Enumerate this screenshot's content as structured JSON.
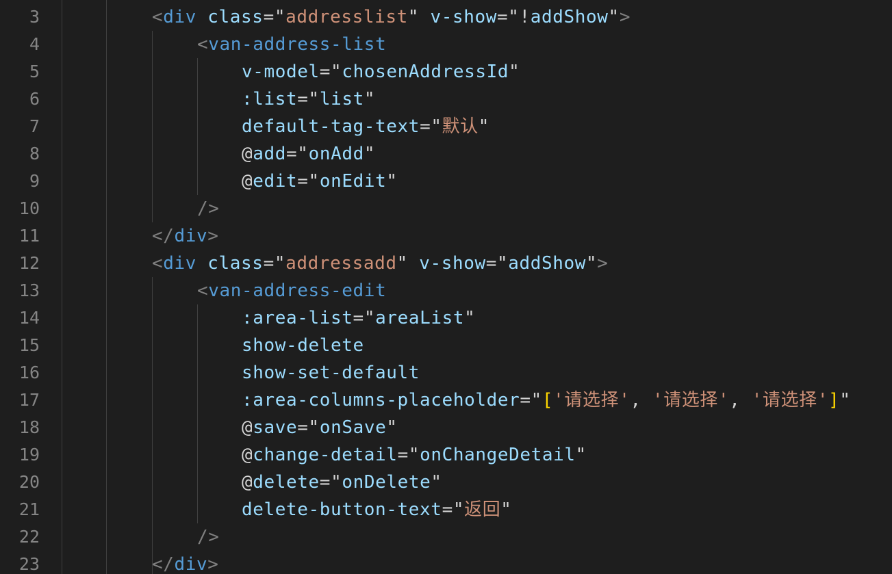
{
  "colors": {
    "background": "#1e1e1e",
    "line_number": "#858585",
    "tag": "#569cd6",
    "attribute": "#9cdcfe",
    "string": "#ce9178",
    "punctuation": "#808080",
    "bracket": "#ffd700",
    "text": "#d4d4d4"
  },
  "lines": [
    {
      "number": "3",
      "indent": 2,
      "tokens": [
        {
          "k": "punct",
          "t": "<"
        },
        {
          "k": "tag",
          "t": "div"
        },
        {
          "k": "plain",
          "t": " "
        },
        {
          "k": "attr",
          "t": "class"
        },
        {
          "k": "eq",
          "t": "="
        },
        {
          "k": "quote",
          "t": "\""
        },
        {
          "k": "str",
          "t": "addresslist"
        },
        {
          "k": "quote",
          "t": "\""
        },
        {
          "k": "plain",
          "t": " "
        },
        {
          "k": "attr",
          "t": "v-show"
        },
        {
          "k": "eq",
          "t": "="
        },
        {
          "k": "quote",
          "t": "\""
        },
        {
          "k": "plain",
          "t": "!"
        },
        {
          "k": "val",
          "t": "addShow"
        },
        {
          "k": "quote",
          "t": "\""
        },
        {
          "k": "punct",
          "t": ">"
        }
      ]
    },
    {
      "number": "4",
      "indent": 3,
      "tokens": [
        {
          "k": "punct",
          "t": "<"
        },
        {
          "k": "tag",
          "t": "van-address-list"
        }
      ]
    },
    {
      "number": "5",
      "indent": 4,
      "tokens": [
        {
          "k": "attr",
          "t": "v-model"
        },
        {
          "k": "eq",
          "t": "="
        },
        {
          "k": "quote",
          "t": "\""
        },
        {
          "k": "val",
          "t": "chosenAddressId"
        },
        {
          "k": "quote",
          "t": "\""
        }
      ]
    },
    {
      "number": "6",
      "indent": 4,
      "tokens": [
        {
          "k": "attr",
          "t": ":list"
        },
        {
          "k": "eq",
          "t": "="
        },
        {
          "k": "quote",
          "t": "\""
        },
        {
          "k": "val",
          "t": "list"
        },
        {
          "k": "quote",
          "t": "\""
        }
      ]
    },
    {
      "number": "7",
      "indent": 4,
      "tokens": [
        {
          "k": "attr",
          "t": "default-tag-text"
        },
        {
          "k": "eq",
          "t": "="
        },
        {
          "k": "quote",
          "t": "\""
        },
        {
          "k": "str",
          "t": "默认"
        },
        {
          "k": "quote",
          "t": "\""
        }
      ]
    },
    {
      "number": "8",
      "indent": 4,
      "tokens": [
        {
          "k": "at",
          "t": "@"
        },
        {
          "k": "attr",
          "t": "add"
        },
        {
          "k": "eq",
          "t": "="
        },
        {
          "k": "quote",
          "t": "\""
        },
        {
          "k": "val",
          "t": "onAdd"
        },
        {
          "k": "quote",
          "t": "\""
        }
      ]
    },
    {
      "number": "9",
      "indent": 4,
      "tokens": [
        {
          "k": "at",
          "t": "@"
        },
        {
          "k": "attr",
          "t": "edit"
        },
        {
          "k": "eq",
          "t": "="
        },
        {
          "k": "quote",
          "t": "\""
        },
        {
          "k": "val",
          "t": "onEdit"
        },
        {
          "k": "quote",
          "t": "\""
        }
      ]
    },
    {
      "number": "10",
      "indent": 3,
      "tokens": [
        {
          "k": "punct",
          "t": "/>"
        }
      ]
    },
    {
      "number": "11",
      "indent": 2,
      "tokens": [
        {
          "k": "punct",
          "t": "</"
        },
        {
          "k": "tag",
          "t": "div"
        },
        {
          "k": "punct",
          "t": ">"
        }
      ]
    },
    {
      "number": "12",
      "indent": 2,
      "tokens": [
        {
          "k": "punct",
          "t": "<"
        },
        {
          "k": "tag",
          "t": "div"
        },
        {
          "k": "plain",
          "t": " "
        },
        {
          "k": "attr",
          "t": "class"
        },
        {
          "k": "eq",
          "t": "="
        },
        {
          "k": "quote",
          "t": "\""
        },
        {
          "k": "str",
          "t": "addressadd"
        },
        {
          "k": "quote",
          "t": "\""
        },
        {
          "k": "plain",
          "t": " "
        },
        {
          "k": "attr",
          "t": "v-show"
        },
        {
          "k": "eq",
          "t": "="
        },
        {
          "k": "quote",
          "t": "\""
        },
        {
          "k": "val",
          "t": "addShow"
        },
        {
          "k": "quote",
          "t": "\""
        },
        {
          "k": "punct",
          "t": ">"
        }
      ]
    },
    {
      "number": "13",
      "indent": 3,
      "tokens": [
        {
          "k": "punct",
          "t": "<"
        },
        {
          "k": "tag",
          "t": "van-address-edit"
        }
      ]
    },
    {
      "number": "14",
      "indent": 4,
      "tokens": [
        {
          "k": "attr",
          "t": ":area-list"
        },
        {
          "k": "eq",
          "t": "="
        },
        {
          "k": "quote",
          "t": "\""
        },
        {
          "k": "val",
          "t": "areaList"
        },
        {
          "k": "quote",
          "t": "\""
        }
      ]
    },
    {
      "number": "15",
      "indent": 4,
      "tokens": [
        {
          "k": "attr",
          "t": "show-delete"
        }
      ]
    },
    {
      "number": "16",
      "indent": 4,
      "tokens": [
        {
          "k": "attr",
          "t": "show-set-default"
        }
      ]
    },
    {
      "number": "17",
      "indent": 4,
      "tokens": [
        {
          "k": "attr",
          "t": ":area-columns-placeholder"
        },
        {
          "k": "eq",
          "t": "="
        },
        {
          "k": "quote",
          "t": "\""
        },
        {
          "k": "bracket",
          "t": "["
        },
        {
          "k": "str",
          "t": "'请选择'"
        },
        {
          "k": "plain",
          "t": ", "
        },
        {
          "k": "str",
          "t": "'请选择'"
        },
        {
          "k": "plain",
          "t": ", "
        },
        {
          "k": "str",
          "t": "'请选择'"
        },
        {
          "k": "bracket",
          "t": "]"
        },
        {
          "k": "quote",
          "t": "\""
        }
      ]
    },
    {
      "number": "18",
      "indent": 4,
      "tokens": [
        {
          "k": "at",
          "t": "@"
        },
        {
          "k": "attr",
          "t": "save"
        },
        {
          "k": "eq",
          "t": "="
        },
        {
          "k": "quote",
          "t": "\""
        },
        {
          "k": "val",
          "t": "onSave"
        },
        {
          "k": "quote",
          "t": "\""
        }
      ]
    },
    {
      "number": "19",
      "indent": 4,
      "tokens": [
        {
          "k": "at",
          "t": "@"
        },
        {
          "k": "attr",
          "t": "change-detail"
        },
        {
          "k": "eq",
          "t": "="
        },
        {
          "k": "quote",
          "t": "\""
        },
        {
          "k": "val",
          "t": "onChangeDetail"
        },
        {
          "k": "quote",
          "t": "\""
        }
      ]
    },
    {
      "number": "20",
      "indent": 4,
      "tokens": [
        {
          "k": "at",
          "t": "@"
        },
        {
          "k": "attr",
          "t": "delete"
        },
        {
          "k": "eq",
          "t": "="
        },
        {
          "k": "quote",
          "t": "\""
        },
        {
          "k": "val",
          "t": "onDelete"
        },
        {
          "k": "quote",
          "t": "\""
        }
      ]
    },
    {
      "number": "21",
      "indent": 4,
      "tokens": [
        {
          "k": "attr",
          "t": "delete-button-text"
        },
        {
          "k": "eq",
          "t": "="
        },
        {
          "k": "quote",
          "t": "\""
        },
        {
          "k": "str",
          "t": "返回"
        },
        {
          "k": "quote",
          "t": "\""
        }
      ]
    },
    {
      "number": "22",
      "indent": 3,
      "tokens": [
        {
          "k": "punct",
          "t": "/>"
        }
      ]
    },
    {
      "number": "23",
      "indent": 2,
      "tokens": [
        {
          "k": "punct",
          "t": "</"
        },
        {
          "k": "tag",
          "t": "div"
        },
        {
          "k": "punct",
          "t": ">"
        }
      ]
    }
  ]
}
